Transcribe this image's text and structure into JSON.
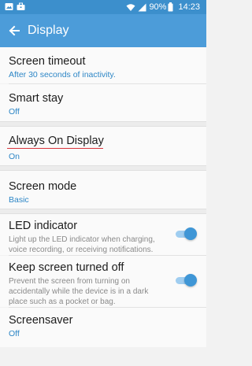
{
  "status_bar": {
    "left_icons": [
      "gallery-icon",
      "briefcase-icon"
    ],
    "battery_percent": "90%",
    "time": "14:23"
  },
  "app_bar": {
    "title": "Display",
    "back_icon": "arrow-left-icon"
  },
  "settings": [
    {
      "label": "Screen timeout",
      "value": "After 30 seconds of inactivity."
    },
    {
      "label": "Smart stay",
      "value": "Off"
    },
    {
      "label": "Always On Display",
      "value": "On"
    },
    {
      "label": "Screen mode",
      "value": "Basic"
    },
    {
      "label": "LED indicator",
      "description": "Light up the LED indicator when charging, voice recording, or receiving notifications.",
      "enabled": true
    },
    {
      "label": "Keep screen turned off",
      "description": "Prevent the screen from turning on accidentally while the device is in a dark place such as a pocket or bag.",
      "enabled": true
    },
    {
      "label": "Screensaver",
      "value": "Off"
    }
  ],
  "colors": {
    "status_bar": "#3c8fcc",
    "app_bar": "#4c9cd9",
    "accent": "#3f96d6",
    "highlight_underline": "#d9323a"
  }
}
